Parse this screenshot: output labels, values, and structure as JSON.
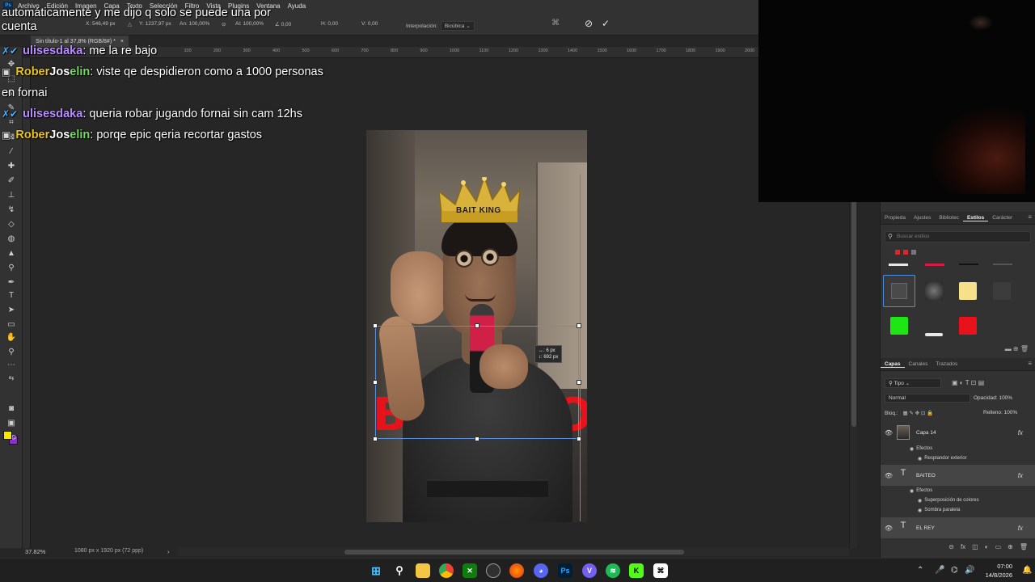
{
  "menubar": {
    "app_logo": "Ps",
    "items": [
      "Archivo",
      "Edición",
      "Imagen",
      "Capa",
      "Texto",
      "Selección",
      "Filtro",
      "Vista",
      "Plugins",
      "Ventana",
      "Ayuda"
    ]
  },
  "options": {
    "x_label": "X:",
    "x_value": "546,49 px",
    "y_label": "Y:",
    "y_value": "1237,97 px",
    "w_label": "An:",
    "w_value": "100,00%",
    "h_label": "Al:",
    "h_value": "100,00%",
    "angle_value": "0,00",
    "hskew_label": "H:",
    "hskew_value": "0,00",
    "vskew_label": "V:",
    "vskew_value": "0,00",
    "interp_label": "Interpolación:",
    "interp_value": "Bicúbica"
  },
  "document": {
    "tab_title": "Sin título-1 al 37,8% (RGB/8#) *",
    "tab_close": "×",
    "zoom": "37.82%",
    "dimensions": "1080 px x 1920 px (72 ppp)",
    "status_arrow": "›"
  },
  "ruler_marks": [
    "200",
    "100",
    "0",
    "100",
    "200",
    "300",
    "400",
    "500",
    "600",
    "700",
    "800",
    "900",
    "1000",
    "1100",
    "1200",
    "1300",
    "1400",
    "1500",
    "1600",
    "1700",
    "1800",
    "1900",
    "2000"
  ],
  "canvas": {
    "crown_text": "BAIT KING",
    "letter_left": "B",
    "letter_right": "O",
    "tooltip_line1": "↔: 6 px",
    "tooltip_line2": "↕: 692 px"
  },
  "chat": {
    "top_text": "automáticamente y me dijo q solo se puede una por cuenta",
    "messages": [
      {
        "badge": "✗✔",
        "user": "ulisesdaka",
        "text": "me la re bajo"
      },
      {
        "badge": "▣",
        "user_parts": [
          "Rober",
          "Jos",
          "elin"
        ],
        "text": "viste qe despidieron como a 1000 personas en fornai"
      },
      {
        "badge": "✗✔",
        "user": "ulisesdaka",
        "text": "queria robar jugando fornai sin cam 12hs"
      },
      {
        "badge": "▣",
        "user_parts": [
          "Rober",
          "Jos",
          "elin"
        ],
        "text": "porqe epic qeria recortar gastos"
      }
    ]
  },
  "styles_panel": {
    "tabs": [
      "Propieda",
      "Ajustes",
      "Bibliotec",
      "Estilos",
      "Carácter"
    ],
    "active_tab": "Estilos",
    "search_placeholder": "Buscar estilos"
  },
  "layers_panel": {
    "tabs": [
      "Capas",
      "Canales",
      "Trazados"
    ],
    "active_tab": "Capas",
    "filter_label": "Tipo",
    "blend_mode": "Normal",
    "opacity_label": "Opacidad:",
    "opacity_value": "100%",
    "lock_label": "Bloq.:",
    "fill_label": "Relleno:",
    "fill_value": "100%",
    "fx_label": "fx",
    "effects_label": "Efectos",
    "layers": [
      {
        "name": "Capa 14",
        "type": "image",
        "effects": [
          "Resplandor exterior"
        ]
      },
      {
        "name": "BAITEO",
        "type": "text",
        "effects": [
          "Superposición de colores",
          "Sombra paralela"
        ]
      },
      {
        "name": "EL REY",
        "type": "text",
        "effects": []
      }
    ]
  },
  "taskbar": {
    "time": "07:00",
    "date": "14/8/2026",
    "apps": [
      "windows-start",
      "search",
      "file-explorer",
      "chrome",
      "xbox",
      "obs",
      "firefox",
      "discord",
      "photoshop",
      "viber",
      "spotify",
      "kick",
      "capcut"
    ]
  },
  "colors": {
    "foreground": "#f5e60a",
    "background": "#8b2fc9",
    "accent_red": "#e8121b"
  }
}
